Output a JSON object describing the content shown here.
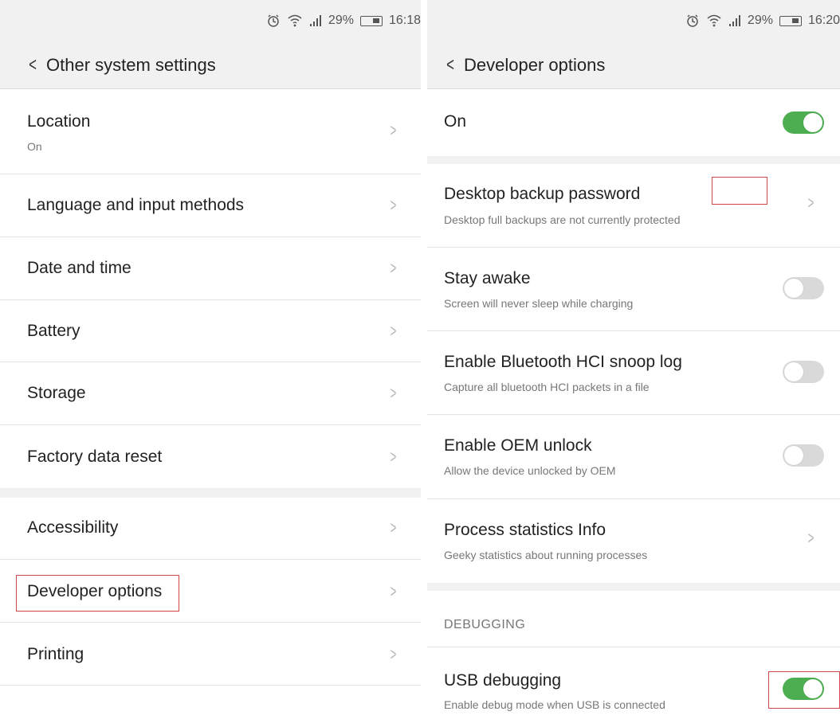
{
  "left": {
    "status": {
      "percent": "29%",
      "time": "16:18"
    },
    "title": "Other system settings",
    "items": [
      {
        "label": "Location",
        "sub": "On"
      },
      {
        "label": "Language and input methods"
      },
      {
        "label": "Date and time"
      },
      {
        "label": "Battery"
      },
      {
        "label": "Storage"
      },
      {
        "label": "Factory data reset"
      },
      {
        "label": "Accessibility"
      },
      {
        "label": "Developer options"
      },
      {
        "label": "Printing"
      }
    ]
  },
  "right": {
    "status": {
      "percent": "29%",
      "time": "16:20"
    },
    "title": "Developer options",
    "master": {
      "label": "On",
      "state": "on"
    },
    "items": [
      {
        "label": "Desktop backup password",
        "sub": "Desktop full backups are not currently protected",
        "control": "chevron"
      },
      {
        "label": "Stay awake",
        "sub": "Screen will never sleep while charging",
        "control": "toggle",
        "state": "off"
      },
      {
        "label": "Enable Bluetooth HCI snoop log",
        "sub": "Capture all bluetooth HCI packets in a file",
        "control": "toggle",
        "state": "off"
      },
      {
        "label": "Enable OEM unlock",
        "sub": "Allow the device unlocked by OEM",
        "control": "toggle",
        "state": "off"
      },
      {
        "label": "Process statistics Info",
        "sub": "Geeky statistics about running processes",
        "control": "chevron"
      }
    ],
    "section_header": "DEBUGGING",
    "debug_items": [
      {
        "label": "USB debugging",
        "sub": "Enable debug mode when USB is connected",
        "control": "toggle",
        "state": "on"
      }
    ]
  },
  "colors": {
    "toggle_on": "#4cae50",
    "toggle_off": "#d9d9d9",
    "highlight": "#d04848",
    "band": "#f1f1f1"
  },
  "icons": {
    "alarm": "alarm-icon",
    "wifi": "wifi-icon",
    "signal": "signal-icon",
    "battery": "battery-icon",
    "back": "back-chevron-icon",
    "chevron": "chevron-right-icon"
  }
}
